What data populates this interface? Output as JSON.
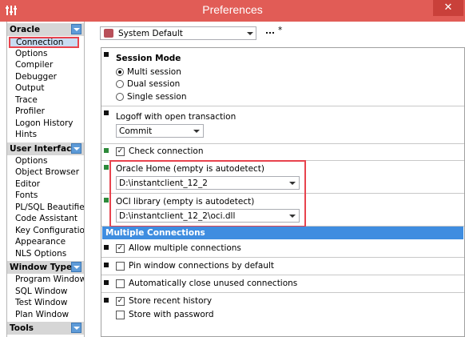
{
  "window": {
    "title": "Preferences",
    "close_glyph": "✕"
  },
  "sidebar": {
    "groups": [
      {
        "label": "Oracle",
        "items": [
          "Connection",
          "Options",
          "Compiler",
          "Debugger",
          "Output",
          "Trace",
          "Profiler",
          "Logon History",
          "Hints"
        ]
      },
      {
        "label": "User Interface",
        "items": [
          "Options",
          "Object Browser",
          "Editor",
          "Fonts",
          "PL/SQL Beautifier",
          "Code Assistant",
          "Key Configuration",
          "Appearance",
          "NLS Options"
        ]
      },
      {
        "label": "Window Types",
        "items": [
          "Program Window",
          "SQL Window",
          "Test Window",
          "Plan Window"
        ]
      },
      {
        "label": "Tools",
        "items": []
      }
    ],
    "selected": "Connection"
  },
  "toolbar": {
    "profile": "System Default",
    "dots": "...",
    "star": "*"
  },
  "session": {
    "title": "Session Mode",
    "options": [
      "Multi session",
      "Dual session",
      "Single session"
    ],
    "selected_index": 0
  },
  "logoff": {
    "label": "Logoff with open transaction",
    "value": "Commit"
  },
  "check_connection": {
    "label": "Check connection",
    "checked": true
  },
  "oracle_home": {
    "label": "Oracle Home (empty is autodetect)",
    "value": "D:\\instantclient_12_2"
  },
  "oci_library": {
    "label": "OCI library (empty is autodetect)",
    "value": "D:\\instantclient_12_2\\oci.dll"
  },
  "multiple_connections": {
    "header": "Multiple Connections",
    "allow": {
      "label": "Allow multiple connections",
      "checked": true
    },
    "pin": {
      "label": "Pin window connections by default",
      "checked": false
    },
    "autoclose": {
      "label": "Automatically close unused connections",
      "checked": false
    },
    "store_history": {
      "label": "Store recent history",
      "checked": true
    },
    "store_password": {
      "label": "Store with password",
      "checked": false
    }
  },
  "check_glyph": "✓",
  "colors": {
    "titlebar": "#e15c56",
    "section_header": "#3f8de0",
    "highlight_box": "#e8434d",
    "marker_green": "#2d8a3a"
  }
}
